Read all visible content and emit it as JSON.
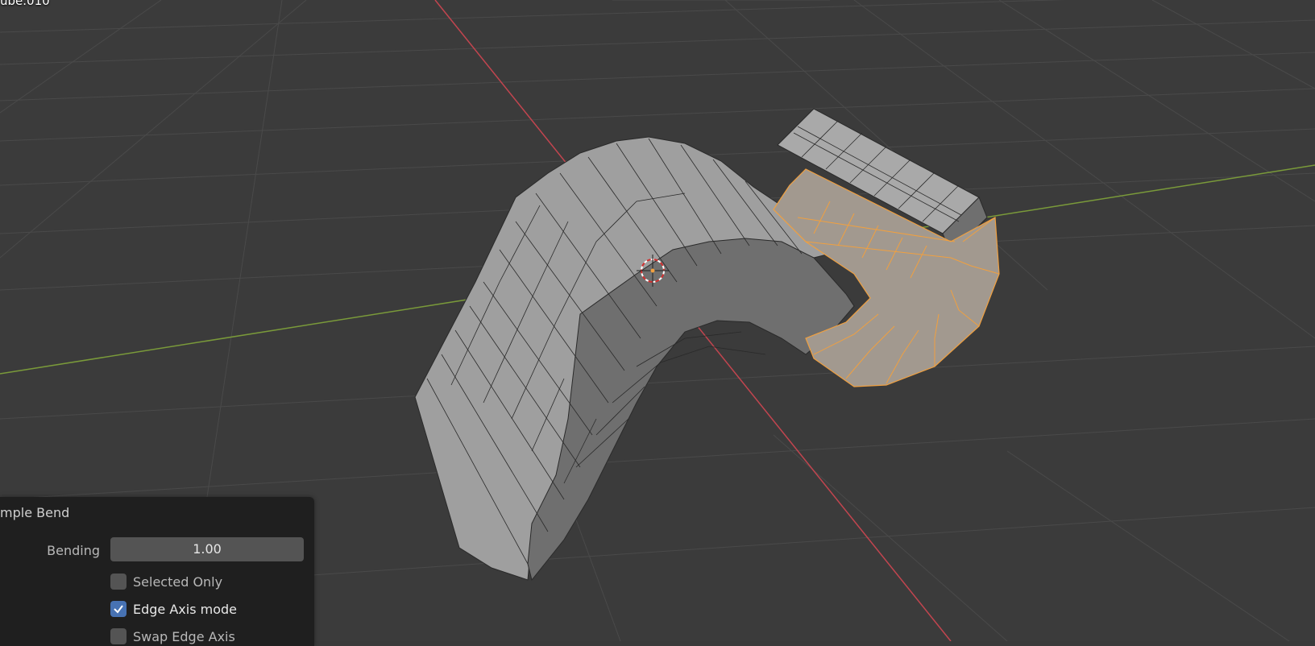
{
  "viewport": {
    "object_name": "ube.010"
  },
  "operator_panel": {
    "title": "mple Bend",
    "bending_label": "Bending",
    "bending_value": "1.00",
    "options": [
      {
        "label": "Selected Only",
        "checked": false
      },
      {
        "label": "Edge Axis mode",
        "checked": true
      },
      {
        "label": "Swap Edge Axis",
        "checked": false
      }
    ]
  },
  "colors": {
    "background": "#3b3b3b",
    "grid": "#4a4a4a",
    "x_axis": "#c2454f",
    "y_axis": "#7a9a3a",
    "mesh_face": "#9d9d9d",
    "selection": "#f0a040",
    "checkbox_accent": "#4772b3"
  },
  "icons": {
    "cursor": "3d-cursor-icon",
    "check": "checkmark-icon"
  }
}
